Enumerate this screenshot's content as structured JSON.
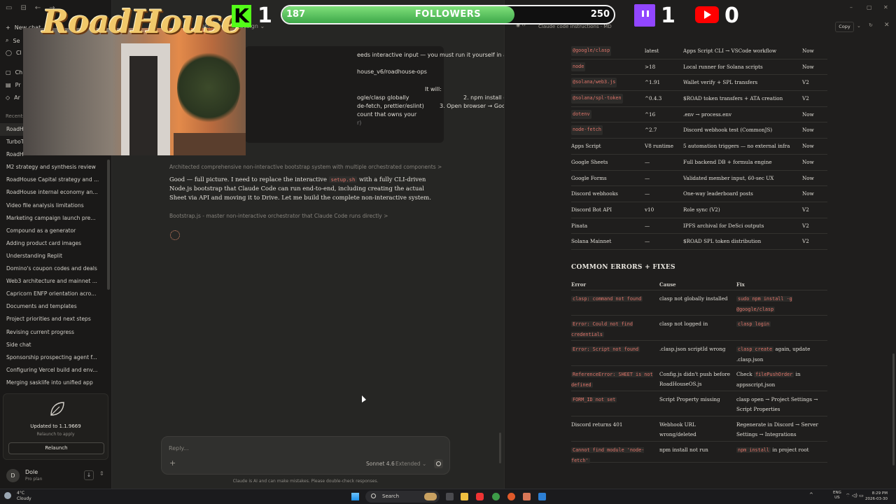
{
  "sidebar": {
    "top_icons": [
      "▭",
      "⊟",
      "←",
      "→"
    ],
    "new_chat": "New chat",
    "nav": [
      {
        "icon": "⌕",
        "label": "Se"
      },
      {
        "icon": "◯",
        "label": "Cl"
      },
      {
        "icon": "▢",
        "label": "Ch"
      },
      {
        "icon": "▤",
        "label": "Pr"
      },
      {
        "icon": "◇",
        "label": "Ar"
      }
    ],
    "recents_label": "Recents",
    "items": [
      {
        "label": "RoadH",
        "active": true
      },
      {
        "label": "TurboT"
      },
      {
        "label": "RoadH"
      },
      {
        "label": "M2 strategy and synthesis review"
      },
      {
        "label": "RoadHouse Capital strategy and ..."
      },
      {
        "label": "RoadHouse internal economy an..."
      },
      {
        "label": "Video file analysis limitations"
      },
      {
        "label": "Marketing campaign launch pre..."
      },
      {
        "label": "Compound as a generator"
      },
      {
        "label": "Adding product card images"
      },
      {
        "label": "Understanding Replit"
      },
      {
        "label": "Domino's coupon codes and deals"
      },
      {
        "label": "Web3 architecture and mainnet ..."
      },
      {
        "label": "Capricorn ENFP orientation acro..."
      },
      {
        "label": "Documents and templates"
      },
      {
        "label": "Project priorities and next steps"
      },
      {
        "label": "Revising current progress"
      },
      {
        "label": "Side chat"
      },
      {
        "label": "Sponsorship prospecting agent f..."
      },
      {
        "label": "Configuring Vercel build and env..."
      },
      {
        "label": "Merging sasklife into unified app"
      }
    ],
    "update": {
      "title": "Updated to 1.1.9669",
      "subtitle": "Relaunch to apply",
      "button": "Relaunch"
    },
    "user": {
      "initial": "D",
      "name": "Dole",
      "plan": "Pro plan"
    }
  },
  "overlay": {
    "logo": "RoadHouse",
    "kick_count": "1",
    "followers": {
      "start": "187",
      "label": "FOLLOWERS",
      "end": "250",
      "progress": 0.7
    },
    "twitch_count": "1",
    "youtube_count": "0",
    "colors": {
      "kick": "#53fc18",
      "twitch": "#9146ff",
      "youtube": "#ff0000"
    }
  },
  "chat": {
    "title": "ating system design  ⌄",
    "bubble": {
      "line1": "eeds interactive input — you must run it yourself in a real",
      "line2": "house_v6/roadhouse-ops",
      "line3a": "It will:",
      "line3b": "1.",
      "line4a": "ogle/clasp globally",
      "line4b": "2. npm install (Solana SDK,",
      "line5a": "de-fetch, prettier/eslint)",
      "line5b": "3. Open browser → Google auth (sign",
      "line6": "count that owns your",
      "line7": "r)"
    },
    "thinking": "Architected comprehensive non-interactive bootstrap system with multiple orchestrated components  >",
    "para_a": "Good — full picture. I need to replace the interactive ",
    "para_code": "setup.sh",
    "para_b": " with a fully CLI-driven Node.js bootstrap that Claude Code can run end-to-end, including creating the actual Sheet via API and moving it to Drive. Let me build the complete non-interactive system.",
    "artifact": "Bootstrap.js - master non-interactive orchestrator that Claude Code runs directly  >",
    "composer": {
      "placeholder": "Reply...",
      "plus": "+",
      "model": "Sonnet 4.6",
      "mode": "Extended ⌄"
    },
    "disclaimer": "Claude is AI and can make mistakes. Please double-check responses."
  },
  "panel": {
    "icons": "◉ ‹›",
    "title": "Claude code instructions · MD",
    "copy": "Copy",
    "dropdown": "⌄",
    "refresh": "↻",
    "close": "✕",
    "deps": [
      {
        "name": "@google/clasp",
        "mono": true,
        "version": "latest",
        "purpose": "Apps Script CLI → VSCode workflow",
        "when": "Now"
      },
      {
        "name": "node",
        "mono": true,
        "version": ">18",
        "purpose": "Local runner for Solana scripts",
        "when": "Now"
      },
      {
        "name": "@solana/web3.js",
        "mono": true,
        "version": "^1.91",
        "purpose": "Wallet verify + SPL transfers",
        "when": "V2"
      },
      {
        "name": "@solana/spl-token",
        "mono": true,
        "version": "^0.4.3",
        "purpose": "$ROAD token transfers + ATA creation",
        "when": "V2"
      },
      {
        "name": "dotenv",
        "mono": true,
        "version": "^16",
        "purpose": ".env → process.env",
        "when": "Now"
      },
      {
        "name": "node-fetch",
        "mono": true,
        "version": "^2.7",
        "purpose": "Discord webhook test (CommonJS)",
        "when": "Now"
      },
      {
        "name": "Apps Script",
        "mono": false,
        "version": "V8 runtime",
        "purpose": "5 automation triggers — no external infra",
        "when": "Now"
      },
      {
        "name": "Google Sheets",
        "mono": false,
        "version": "—",
        "purpose": "Full backend DB + formula engine",
        "when": "Now"
      },
      {
        "name": "Google Forms",
        "mono": false,
        "version": "—",
        "purpose": "Validated member input, 60-sec UX",
        "when": "Now"
      },
      {
        "name": "Discord webhooks",
        "mono": false,
        "version": "—",
        "purpose": "One-way leaderboard posts",
        "when": "Now"
      },
      {
        "name": "Discord Bot API",
        "mono": false,
        "version": "v10",
        "purpose": "Role sync (V2)",
        "when": "V2"
      },
      {
        "name": "Pinata",
        "mono": false,
        "version": "—",
        "purpose": "IPFS archival for DeSci outputs",
        "when": "V2"
      },
      {
        "name": "Solana Mainnet",
        "mono": false,
        "version": "—",
        "purpose": "$ROAD SPL token distribution",
        "when": "V2"
      }
    ],
    "errors_heading": "COMMON ERRORS + FIXES",
    "err_cols": {
      "error": "Error",
      "cause": "Cause",
      "fix": "Fix"
    },
    "errors": [
      {
        "error": "clasp: command not found",
        "error_mono": true,
        "cause": "clasp not globally installed",
        "fix_code": "sudo npm install -g @google/clasp",
        "fix_text": ""
      },
      {
        "error": "Error: Could not find credentials",
        "error_mono": true,
        "cause": "clasp not logged in",
        "fix_code": "clasp login",
        "fix_text": ""
      },
      {
        "error": "Error: Script not found",
        "error_mono": true,
        "cause": ".clasp.json scriptId wrong",
        "fix_code": "clasp create",
        "fix_text": " again, update .clasp.json"
      },
      {
        "error": "ReferenceError: SHEET is not defined",
        "error_mono": true,
        "cause": "Config.js didn't push before RoadHouseOS.js",
        "fix_pre": "Check ",
        "fix_code": "filePushOrder",
        "fix_text": " in appsscript.json"
      },
      {
        "error": "FORM_ID not set",
        "error_mono": true,
        "cause": "Script Property missing",
        "fix_code": "",
        "fix_text": "clasp open → Project Settings → Script Properties"
      },
      {
        "error": "Discord returns 401",
        "error_mono": false,
        "cause": "Webhook URL wrong/deleted",
        "fix_code": "",
        "fix_text": "Regenerate in Discord → Server Settings → Integrations"
      },
      {
        "error": "Cannot find module 'node-fetch'",
        "error_mono": true,
        "cause": "npm install not run",
        "fix_code": "npm install",
        "fix_text": " in project root"
      }
    ]
  },
  "window": {
    "minimize": "–",
    "maximize": "▢",
    "close": "✕"
  },
  "taskbar": {
    "temp": "4°C",
    "weather": "Cloudy",
    "search": "Search",
    "tray_arrow": "^",
    "lang_top": "ENG",
    "lang_bottom": "US",
    "tray_icons": "⌔ ◁) ▭",
    "time": "8:29 PM",
    "date": "2026-03-30"
  }
}
